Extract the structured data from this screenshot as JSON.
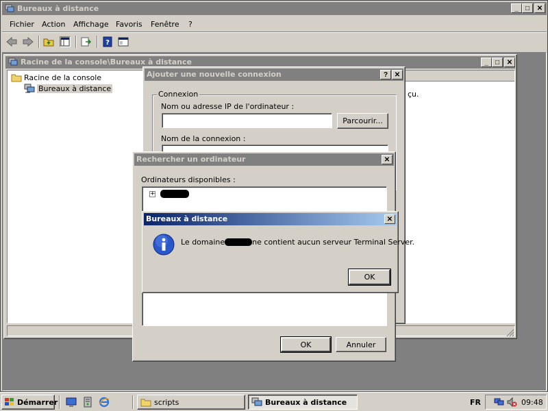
{
  "main_window": {
    "title": "Bureaux à distance",
    "menu": [
      "Fichier",
      "Action",
      "Affichage",
      "Favoris",
      "Fenêtre",
      "?"
    ]
  },
  "console_window": {
    "title": "Racine de la console\\Bureaux à distance",
    "tree": {
      "root": "Racine de la console",
      "child": "Bureaux à distance"
    },
    "right_text_fragment": "çu."
  },
  "add_connection_dialog": {
    "title": "Ajouter une nouvelle connexion",
    "group_label": "Connexion",
    "ip_label": "Nom ou adresse IP de l'ordinateur :",
    "ip_value": "",
    "browse_button": "Parcourir...",
    "connection_name_label": "Nom de la connexion :"
  },
  "find_computer_dialog": {
    "title": "Rechercher un ordinateur",
    "list_label": "Ordinateurs disponibles :",
    "ok_button": "OK",
    "cancel_button": "Annuler"
  },
  "message_box": {
    "title": "Bureaux à distance",
    "message_prefix": "Le domaine ",
    "message_suffix": " ne contient aucun serveur Terminal Server.",
    "ok_button": "OK"
  },
  "taskbar": {
    "start_label": "Démarrer",
    "tasks": [
      {
        "label": "scripts",
        "active": false
      },
      {
        "label": "Bureaux à distance",
        "active": true
      }
    ],
    "language": "FR",
    "clock": "09:48"
  },
  "colors": {
    "desktop": "#6f6f6f",
    "face": "#d4d0c8",
    "active_title_start": "#0a246a",
    "active_title_end": "#a6caf0",
    "inactive_title": "#808080"
  }
}
